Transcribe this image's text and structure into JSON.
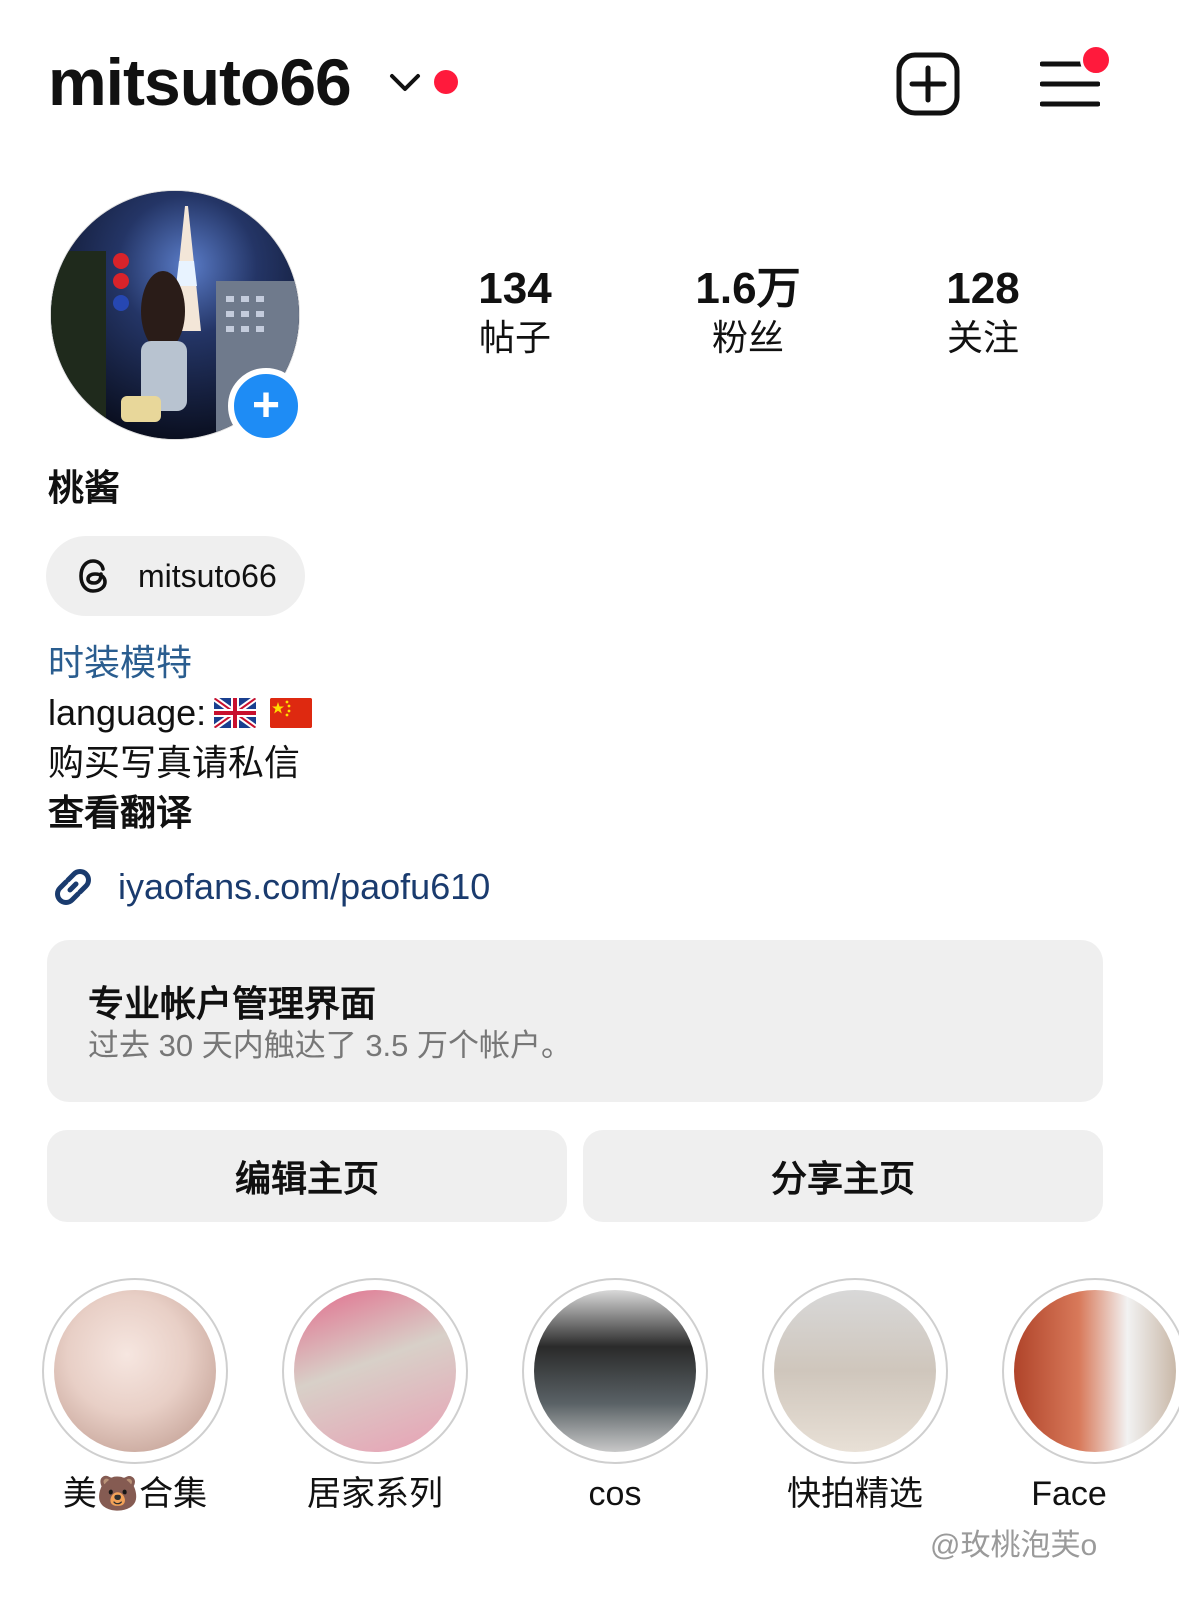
{
  "header": {
    "username": "mitsuto66"
  },
  "profile": {
    "display_name": "桃酱",
    "stats": [
      {
        "value": "134",
        "label": "帖子"
      },
      {
        "value": "1.6万",
        "label": "粉丝"
      },
      {
        "value": "128",
        "label": "关注"
      }
    ],
    "threads_handle": "mitsuto66",
    "bio": {
      "category": "时装模特",
      "language_label": "language:",
      "line3": "购买写真请私信",
      "translate": "查看翻译"
    },
    "link": "iyaofans.com/paofu610"
  },
  "dashboard": {
    "title": "专业帐户管理界面",
    "subtitle": "过去 30 天内触达了 3.5 万个帐户。"
  },
  "buttons": {
    "edit": "编辑主页",
    "share": "分享主页"
  },
  "highlights": [
    {
      "label": "美🐻合集"
    },
    {
      "label": "居家系列"
    },
    {
      "label": "cos"
    },
    {
      "label": "快拍精选"
    },
    {
      "label": "Face"
    }
  ],
  "watermark": "@玫桃泡芙o",
  "colors": {
    "accent_blue": "#1e8cf5",
    "notification_red": "#ff1a3c",
    "category_blue": "#2a5d8f",
    "link_blue": "#1a3b6e"
  }
}
